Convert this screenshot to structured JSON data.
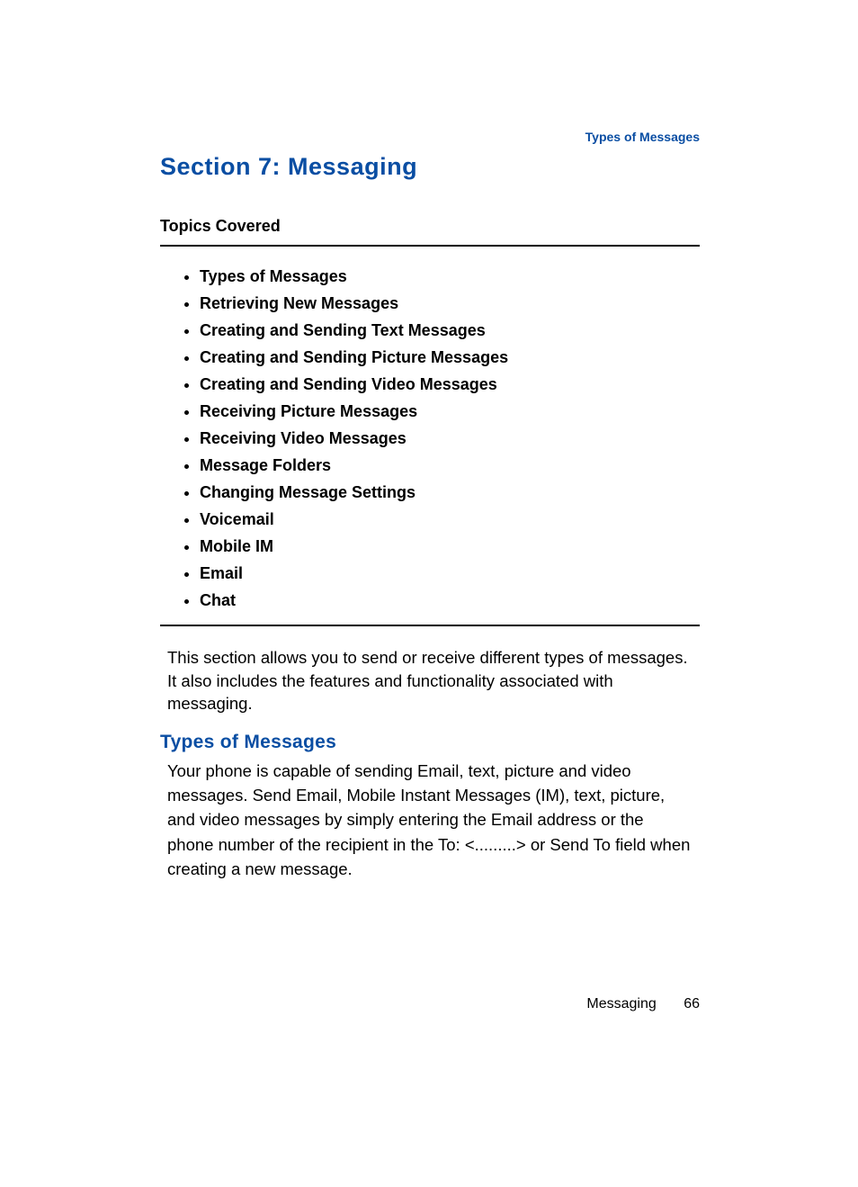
{
  "running_head": "Types of Messages",
  "section_title": "Section 7:  Messaging",
  "topics_label": "Topics Covered",
  "topics": [
    "Types of Messages",
    "Retrieving New Messages",
    "Creating and Sending Text Messages",
    "Creating and Sending Picture Messages",
    "Creating and Sending Video Messages",
    "Receiving Picture Messages",
    "Receiving Video Messages",
    "Message Folders",
    "Changing Message Settings",
    "Voicemail",
    "Mobile IM",
    "Email",
    "Chat"
  ],
  "intro_text": "This section allows you to send or receive different types of messages. It also includes the features and functionality associated with messaging.",
  "subheading": "Types of Messages",
  "body_text": "Your phone is capable of sending Email, text, picture and video messages. Send Email, Mobile Instant Messages (IM), text, picture, and video messages by simply entering the Email address or the phone number of the recipient in the To: <.........> or Send To field when creating a new message.",
  "footer_label": "Messaging",
  "footer_page": "66"
}
